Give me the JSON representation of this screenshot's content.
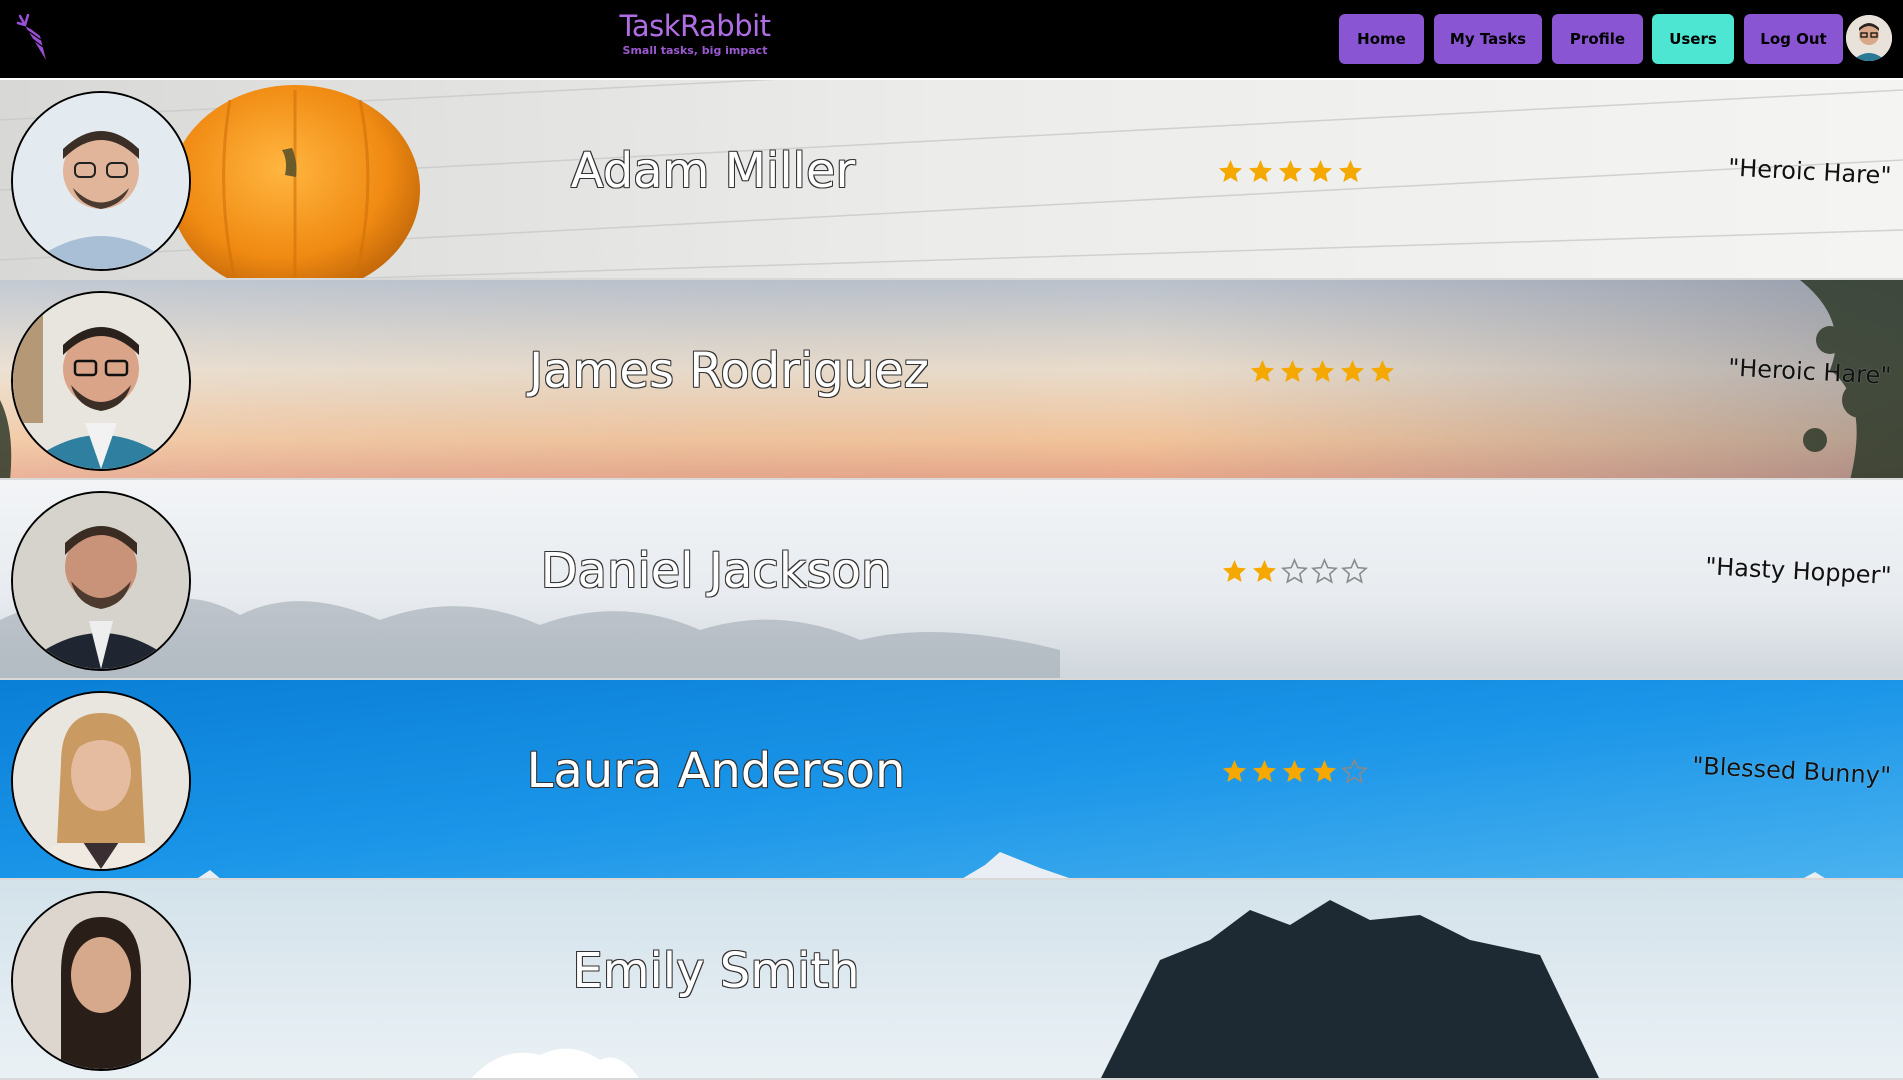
{
  "app": {
    "brand_name": "TaskRabbit",
    "tagline": "Small tasks, big impact",
    "logo_icon": "carrot-icon",
    "brand_color": "#b06ee4"
  },
  "nav": {
    "buttons": [
      {
        "label": "Home",
        "active": false
      },
      {
        "label": "My Tasks",
        "active": false
      },
      {
        "label": "Profile",
        "active": false
      },
      {
        "label": "Users",
        "active": true
      },
      {
        "label": "Log Out",
        "active": false
      }
    ],
    "button_color": "#8a55d3",
    "active_color": "#4ce6d2",
    "avatar_icon": "user-avatar"
  },
  "users": [
    {
      "name": "Adam Miller",
      "rating": 5,
      "max_rating": 5,
      "title": "\"Heroic Hare\"",
      "background": "pumpkin-on-wood"
    },
    {
      "name": "James Rodriguez",
      "rating": 5,
      "max_rating": 5,
      "title": "\"Heroic Hare\"",
      "background": "sunset-sky"
    },
    {
      "name": "Daniel Jackson",
      "rating": 2,
      "max_rating": 5,
      "title": "\"Hasty Hopper\"",
      "background": "foggy-forest"
    },
    {
      "name": "Laura Anderson",
      "rating": 4,
      "max_rating": 5,
      "title": "\"Blessed Bunny\"",
      "background": "blue-sky-mountains"
    },
    {
      "name": "Emily Smith",
      "rating": null,
      "max_rating": 5,
      "title": "",
      "background": "mountain-peaks"
    }
  ],
  "colors": {
    "star_filled": "#f5a800",
    "star_empty": "#8a8a8a",
    "navbar_bg": "#000000"
  }
}
